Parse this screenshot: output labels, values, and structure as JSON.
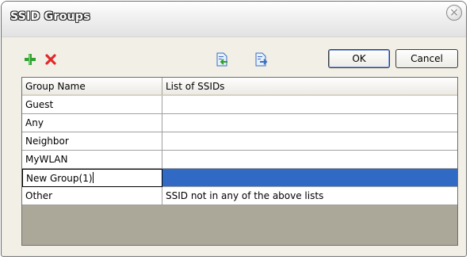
{
  "dialog": {
    "title": "SSID Groups",
    "close_symbol": "×"
  },
  "toolbar": {
    "add_icon": "plus-icon",
    "delete_icon": "x-icon",
    "import_icon": "import-icon",
    "export_icon": "export-icon",
    "ok_label": "OK",
    "cancel_label": "Cancel"
  },
  "grid": {
    "headers": [
      "Group Name",
      "List of SSIDs"
    ],
    "rows": [
      {
        "name": "Guest",
        "ssids": ""
      },
      {
        "name": "Any",
        "ssids": ""
      },
      {
        "name": "Neighbor",
        "ssids": ""
      },
      {
        "name": "MyWLAN",
        "ssids": ""
      },
      {
        "name": "New Group(1)",
        "ssids": ""
      },
      {
        "name": "Other",
        "ssids": "SSID not in any of the above lists"
      }
    ]
  },
  "colors": {
    "selection": "#316ac5",
    "add_green": "#2ea12e",
    "delete_red": "#e02a2a",
    "empty_area": "#aca899"
  }
}
